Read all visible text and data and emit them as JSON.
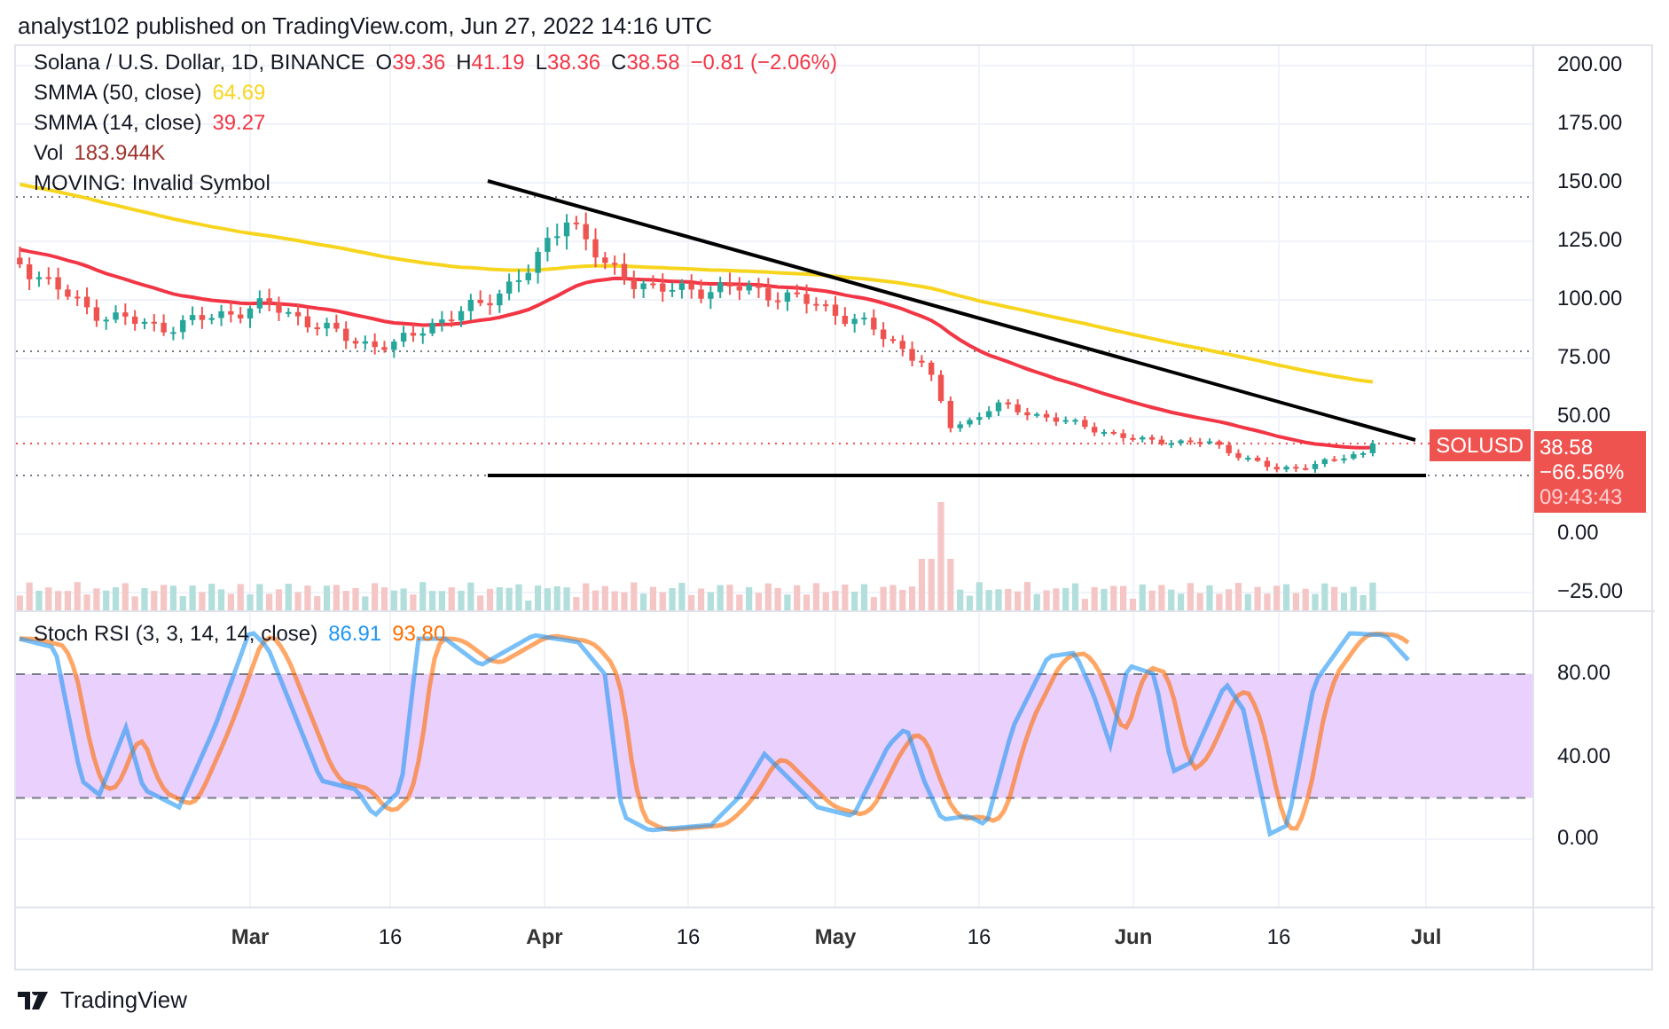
{
  "header": "analyst102 published on TradingView.com, Jun 27, 2022 14:16 UTC",
  "legend": {
    "symbol": "Solana / U.S. Dollar, 1D, BINANCE",
    "ohlc": [
      {
        "key": "O",
        "value": "39.36"
      },
      {
        "key": "H",
        "value": "41.19"
      },
      {
        "key": "L",
        "value": "38.36"
      },
      {
        "key": "C",
        "value": "38.58"
      }
    ],
    "change": "−0.81 (−2.06%)"
  },
  "indicators": [
    {
      "name": "SMMA (50, close)",
      "value": "64.69",
      "color": "#f7d51f"
    },
    {
      "name": "SMMA (14, close)",
      "value": "39.27",
      "color": "#f23645"
    },
    {
      "name": "Vol",
      "value": "183.944K",
      "color": "#a0332d"
    },
    {
      "name": "MOVING: Invalid Symbol"
    }
  ],
  "price_axis": [
    "200.00",
    "175.00",
    "150.00",
    "125.00",
    "100.00",
    "75.00",
    "50.00",
    "0.00",
    "−25.00"
  ],
  "price_tag": {
    "symbol": "SOLUSD",
    "price": "38.58",
    "change": "−66.56%",
    "countdown": "09:43:43"
  },
  "stoch": {
    "name": "Stoch RSI (3, 3, 14, 14, close)",
    "values": [
      {
        "value": "86.91",
        "color": "#2196f3"
      },
      {
        "value": "93.80",
        "color": "#ff6d00"
      }
    ]
  },
  "stoch_axis": [
    "80.00",
    "40.00",
    "0.00"
  ],
  "time_axis": [
    "Mar",
    "16",
    "Apr",
    "16",
    "May",
    "16",
    "Jun",
    "16",
    "Jul"
  ],
  "footer": {
    "brand": "TradingView"
  }
}
